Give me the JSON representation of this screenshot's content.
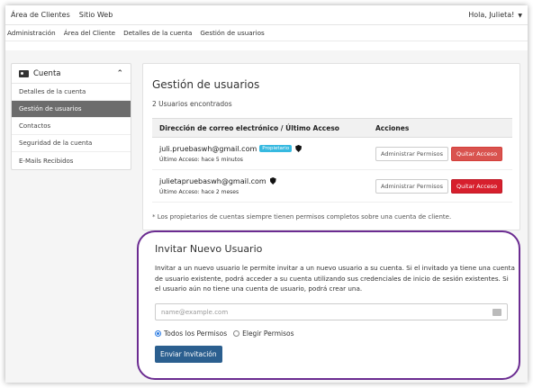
{
  "topbar": {
    "client_area": "Área de Clientes",
    "website": "Sitio Web",
    "greeting": "Hola, Julieta!"
  },
  "subnav": [
    "Administración",
    "Área del Cliente",
    "Detalles de la cuenta",
    "Gestión de usuarios"
  ],
  "sidebar": {
    "header": "Cuenta",
    "items": [
      {
        "label": "Detalles de la cuenta"
      },
      {
        "label": "Gestión de usuarios"
      },
      {
        "label": "Contactos"
      },
      {
        "label": "Seguridad de la cuenta"
      },
      {
        "label": "E-Mails Recibidos"
      }
    ]
  },
  "users": {
    "title": "Gestión de usuarios",
    "found": "2 Usuarios encontrados",
    "col_email": "Dirección de correo electrónico / Último Acceso",
    "col_actions": "Acciones",
    "rows": [
      {
        "email": "juli.pruebaswh@gmail.com",
        "badge": "Propietario",
        "last": "Último Acceso: hace 5 minutos",
        "manage": "Administrar Permisos",
        "remove": "Quitar Acceso"
      },
      {
        "email": "julietapruebaswh@gmail.com",
        "last": "Último Acceso: hace 2 meses",
        "manage": "Administrar Permisos",
        "remove": "Quitar Acceso"
      }
    ],
    "note": "* Los propietarios de cuentas siempre tienen permisos completos sobre una cuenta de cliente."
  },
  "invite": {
    "title": "Invitar Nuevo Usuario",
    "desc": "Invitar a un nuevo usuario le permite invitar a un nuevo usuario a su cuenta. Si el invitado ya tiene una cuenta de usuario existente, podrá acceder a su cuenta utilizando sus credenciales de inicio de sesión existentes. Si el usuario aún no tiene una cuenta de usuario, podrá crear una.",
    "placeholder": "name@example.com",
    "opt_all": "Todos los Permisos",
    "opt_choose": "Elegir Permisos",
    "send": "Enviar Invitación"
  },
  "colors": {
    "highlight": "#6b2c91",
    "send_button": "#2b5f8f",
    "remove_button": "#d9534f",
    "badge": "#36b9e0"
  }
}
